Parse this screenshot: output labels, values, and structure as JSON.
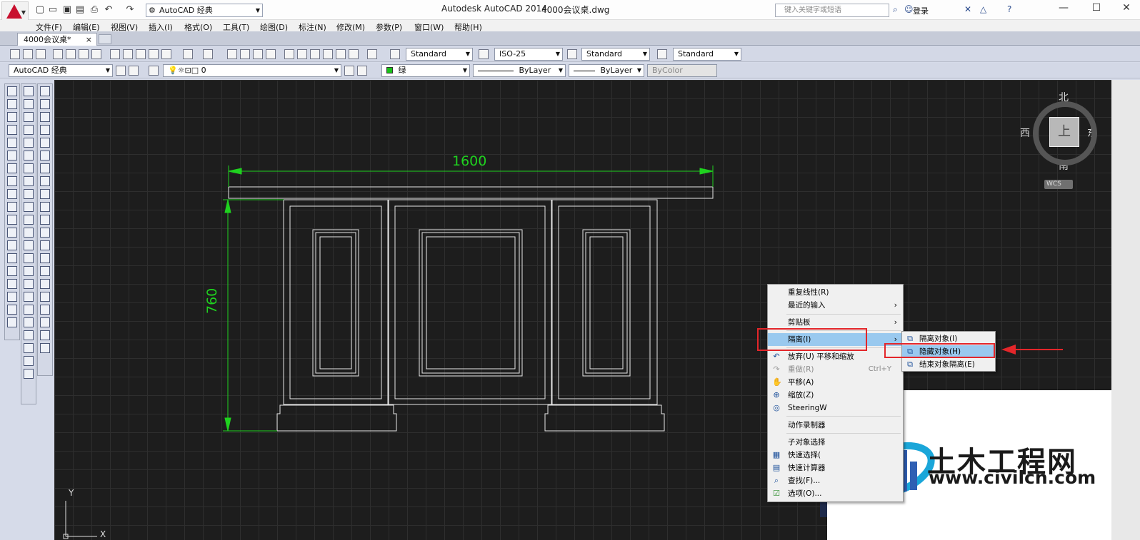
{
  "window": {
    "app_title": "Autodesk AutoCAD 2014",
    "file_title": "4000会议桌.dwg",
    "workspace": "AutoCAD 经典",
    "search_placeholder": "键入关键字或短语",
    "login_label": "登录"
  },
  "menus": [
    "文件(F)",
    "编辑(E)",
    "视图(V)",
    "插入(I)",
    "格式(O)",
    "工具(T)",
    "绘图(D)",
    "标注(N)",
    "修改(M)",
    "参数(P)",
    "窗口(W)",
    "帮助(H)"
  ],
  "tabs": {
    "active": "4000会议桌*",
    "close": "×"
  },
  "styles_toolbar": {
    "text_style": "Standard",
    "dim_style": "ISO-25",
    "table_style": "Standard",
    "mleader_style": "Standard"
  },
  "layers_toolbar": {
    "workspace": "AutoCAD 经典",
    "layer": "0",
    "color": "绿",
    "linetype": "ByLayer",
    "lineweight": "ByLayer",
    "plotstyle": "ByColor"
  },
  "drawing": {
    "dim_width": "1600",
    "dim_height": "760"
  },
  "viewcube": {
    "north": "北",
    "south": "南",
    "east": "东",
    "west": "西",
    "face": "上",
    "wcs": "WCS"
  },
  "ucs": {
    "x": "X",
    "y": "Y"
  },
  "context_menu": {
    "items": [
      {
        "label": "重复线性(R)",
        "arrow": "",
        "shortcut": "",
        "icon": ""
      },
      {
        "label": "最近的输入",
        "arrow": "›",
        "shortcut": "",
        "icon": ""
      },
      {
        "label": "剪贴板",
        "arrow": "›",
        "shortcut": "",
        "icon": ""
      },
      {
        "label": "隔离(I)",
        "arrow": "›",
        "shortcut": "",
        "icon": ""
      },
      {
        "label": "放弃(U) 平移和缩放",
        "arrow": "",
        "shortcut": "",
        "icon": "↶"
      },
      {
        "label": "重做(R)",
        "arrow": "",
        "shortcut": "Ctrl+Y",
        "icon": "↷"
      },
      {
        "label": "平移(A)",
        "arrow": "",
        "shortcut": "",
        "icon": "✋"
      },
      {
        "label": "缩放(Z)",
        "arrow": "",
        "shortcut": "",
        "icon": "⊕"
      },
      {
        "label": "SteeringW",
        "arrow": "",
        "shortcut": "",
        "icon": "◎"
      },
      {
        "label": "动作录制器",
        "arrow": "",
        "shortcut": "",
        "icon": ""
      },
      {
        "label": "子对象选择",
        "arrow": "",
        "shortcut": "",
        "icon": ""
      },
      {
        "label": "快速选择(",
        "arrow": "",
        "shortcut": "",
        "icon": "▦"
      },
      {
        "label": "快速计算器",
        "arrow": "",
        "shortcut": "",
        "icon": "▤"
      },
      {
        "label": "查找(F)...",
        "arrow": "",
        "shortcut": "",
        "icon": "⌕"
      },
      {
        "label": "选项(O)...",
        "arrow": "",
        "shortcut": "",
        "icon": "☑"
      }
    ]
  },
  "isolate_submenu": {
    "items": [
      {
        "label": "隔离对象(I)"
      },
      {
        "label": "隐藏对象(H)"
      },
      {
        "label": "结束对象隔离(E)"
      }
    ]
  },
  "watermark": {
    "name": "土木工程网",
    "url": "www.civilcn.com"
  },
  "colors": {
    "dimension": "#1fd21f",
    "highlight": "#99c9ef",
    "annotation_red": "#e3262a",
    "canvas": "#1d1d1d"
  }
}
